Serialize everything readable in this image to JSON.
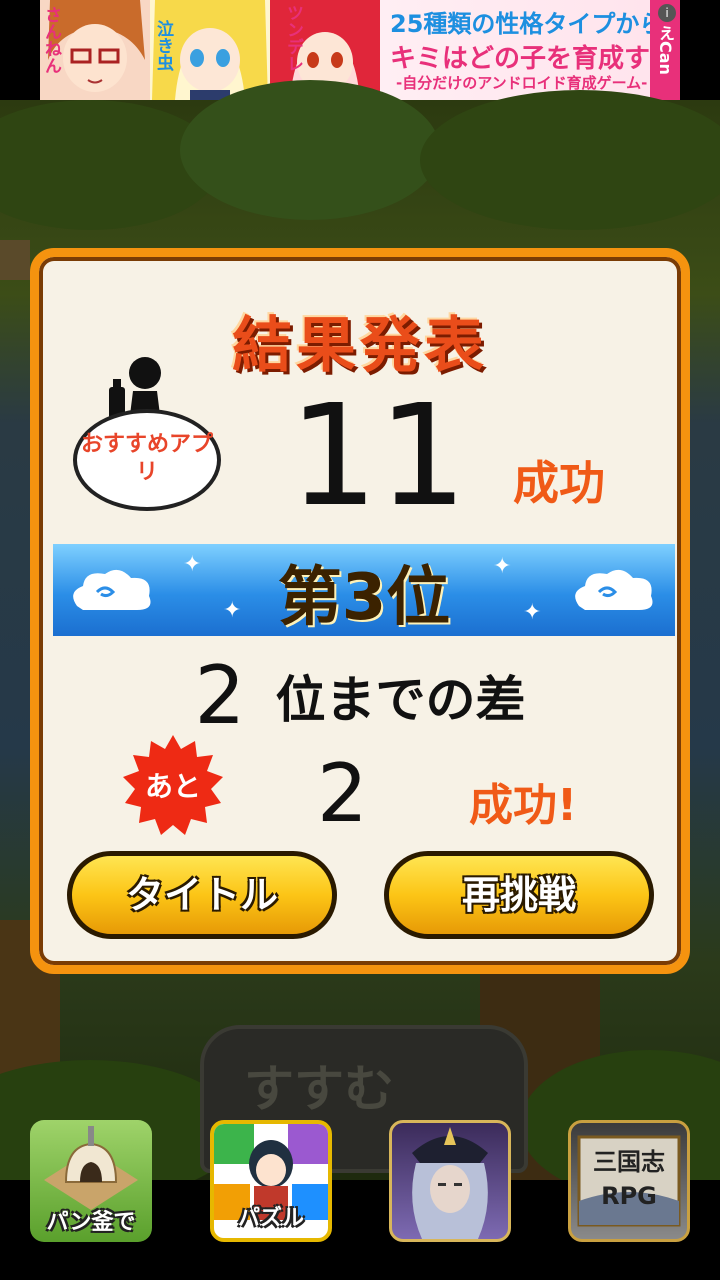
{
  "ad": {
    "char_labels": [
      "さんねん",
      "泣き虫",
      "ツンデレ"
    ],
    "line1": "25種類の性格タイプから",
    "line2": "キミはどの子を育成する?",
    "line3": "-自分だけのアンドロイド育成ゲーム-",
    "brand": "えCan",
    "info_icon": "i"
  },
  "background": {
    "next_button": "すすむ"
  },
  "result": {
    "title": "結果発表",
    "recommend_label": "おすすめアプリ",
    "score": "11",
    "score_unit": "成功",
    "rank": "第3位",
    "gap_number": "2",
    "gap_label": "位までの差",
    "remaining_badge": "あと",
    "remaining_number": "2",
    "remaining_unit": "成功!",
    "title_button": "タイトル",
    "retry_button": "再挑戦"
  },
  "apps": [
    {
      "label": "パン釜で",
      "icon": "bread-oven-icon"
    },
    {
      "label": "パズル",
      "icon": "puzzle-character-icon"
    },
    {
      "label": "",
      "icon": "samurai-portrait-icon"
    },
    {
      "label": "三国志RPG",
      "icon": "sangokushi-rpg-icon"
    }
  ],
  "colors": {
    "panel_border": "#f5930f",
    "accent_orange": "#f05a17",
    "button_yellow": "#fcc516",
    "rank_blue": "#2b8ee7"
  }
}
